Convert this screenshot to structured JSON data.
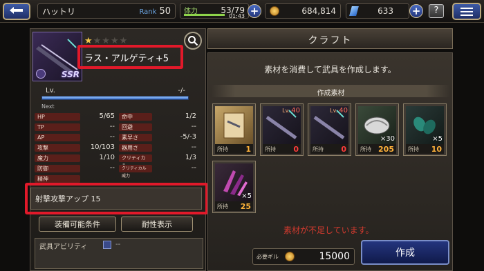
{
  "header": {
    "player_name": "ハットリ",
    "rank_label": "Rank",
    "rank_value": "50",
    "stamina_label": "体力",
    "stamina_value": "53/79",
    "stamina_timer": "01:43",
    "stamina_fill": 0.67,
    "gil_value": "684,814",
    "gem_value": "633",
    "help_label": "?"
  },
  "weapon": {
    "name": "ラス・アルゲティ+5",
    "rarity": "SSR",
    "stars_filled": 1,
    "stars_total": 5,
    "level_label": "Lv.",
    "level_value": "-/-",
    "next_label": "Next",
    "stats": [
      {
        "label": "HP",
        "value": "5/65"
      },
      {
        "label": "命中",
        "value": "1/2"
      },
      {
        "label": "TP",
        "value": "--"
      },
      {
        "label": "回避",
        "value": "--"
      },
      {
        "label": "AP",
        "value": "--"
      },
      {
        "label": "素早さ",
        "value": "-5/-3"
      },
      {
        "label": "攻撃",
        "value": "10/103"
      },
      {
        "label": "器用さ",
        "value": "--"
      },
      {
        "label": "魔力",
        "value": "1/10"
      },
      {
        "label": "クリティカル",
        "value": "1/3"
      },
      {
        "label": "防御",
        "value": "--"
      },
      {
        "label": "クリティカル威力",
        "value": "--"
      },
      {
        "label": "精神",
        "value": ""
      }
    ],
    "passive": "射撃攻撃アップ 15",
    "equip_condition_button": "装備可能条件",
    "durability_button": "耐性表示",
    "ability_label": "武具アビリティ",
    "ability_value": "--"
  },
  "craft": {
    "title": "クラフト",
    "description": "素材を消費して武具を作成します。",
    "materials_header": "作成素材",
    "owned_label": "所持",
    "materials": [
      {
        "icon": "scroll-icon",
        "qty": "",
        "level": "",
        "owned": "1",
        "insufficient": false
      },
      {
        "icon": "weapon-icon",
        "qty": "",
        "level": "40",
        "owned": "0",
        "insufficient": true
      },
      {
        "icon": "weapon-icon",
        "qty": "",
        "level": "40",
        "owned": "0",
        "insufficient": true
      },
      {
        "icon": "shell-icon",
        "qty": "×30",
        "level": "",
        "owned": "205",
        "insufficient": false
      },
      {
        "icon": "seed-icon",
        "qty": "×5",
        "level": "",
        "owned": "10",
        "insufficient": false
      },
      {
        "icon": "crystal-icon",
        "qty": "×5",
        "level": "",
        "owned": "25",
        "insufficient": false
      }
    ],
    "warning": "素材が不足しています。",
    "cost_label": "必要ギル",
    "cost_value": "15000",
    "create_button": "作成"
  },
  "colors": {
    "highlight_box": "#e1192a",
    "warning_text": "#d23a2e",
    "create_button": "#1b2a6b"
  }
}
